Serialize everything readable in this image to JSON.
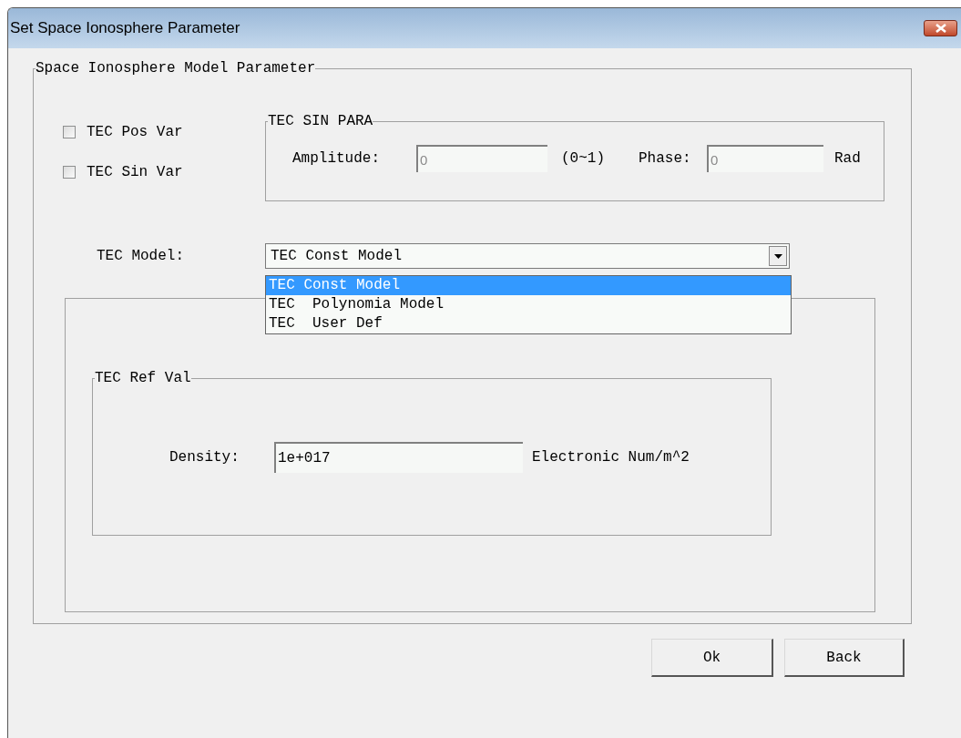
{
  "window": {
    "title": "Set Space Ionosphere Parameter"
  },
  "model_group": {
    "title": "Space Ionosphere Model Parameter",
    "checkboxes": [
      {
        "label": "TEC Pos Var",
        "checked": false
      },
      {
        "label": "TEC Sin Var",
        "checked": false
      }
    ],
    "sin_group": {
      "title": "TEC SIN PARA",
      "amplitude": {
        "label": "Amplitude:",
        "value": "0",
        "range": "(0~1)",
        "disabled": true
      },
      "phase": {
        "label": "Phase:",
        "value": "0",
        "unit": "Rad",
        "disabled": true
      }
    },
    "tec_model": {
      "label": "TEC Model:",
      "value": "TEC Const Model",
      "expanded": true,
      "options": [
        {
          "label": "TEC Const Model",
          "selected": true
        },
        {
          "label": "TEC  Polynomia Model",
          "selected": false
        },
        {
          "label": "TEC  User Def",
          "selected": false
        }
      ]
    },
    "ref_group": {
      "title": "TEC Ref Val",
      "density": {
        "label": "Density:",
        "value": "1e+017",
        "unit": "Electronic Num/m^2"
      }
    }
  },
  "buttons": [
    "Ok",
    "Back"
  ]
}
